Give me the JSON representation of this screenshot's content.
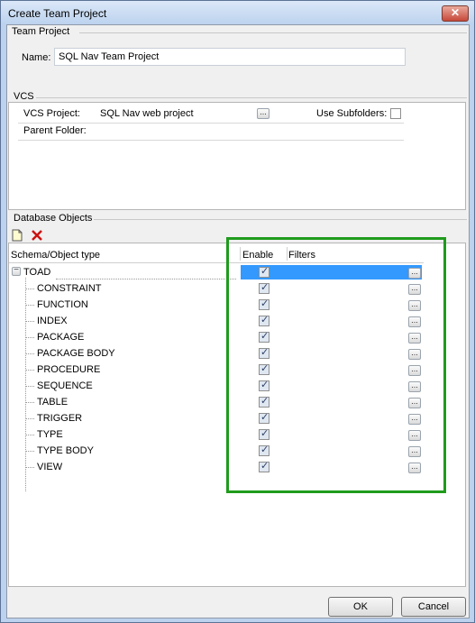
{
  "window": {
    "title": "Create Team Project",
    "close_label": "✕"
  },
  "team_project": {
    "section": "Team Project",
    "name_label": "Name:",
    "name_value": "SQL Nav Team Project"
  },
  "vcs": {
    "section": "VCS",
    "project_label": "VCS Project:",
    "project_value": "SQL Nav web project",
    "browse_label": "...",
    "use_subfolders_label": "Use Subfolders:",
    "use_subfolders_checked": false,
    "parent_folder_label": "Parent Folder:"
  },
  "db": {
    "section": "Database Objects",
    "columns": {
      "schema": "Schema/Object type",
      "enable": "Enable",
      "filters": "Filters"
    },
    "root": {
      "label": "TOAD",
      "enabled": true,
      "expand": "−"
    },
    "items": [
      {
        "label": "CONSTRAINT",
        "enabled": true
      },
      {
        "label": "FUNCTION",
        "enabled": true
      },
      {
        "label": "INDEX",
        "enabled": true
      },
      {
        "label": "PACKAGE",
        "enabled": true
      },
      {
        "label": "PACKAGE BODY",
        "enabled": true
      },
      {
        "label": "PROCEDURE",
        "enabled": true
      },
      {
        "label": "SEQUENCE",
        "enabled": true
      },
      {
        "label": "TABLE",
        "enabled": true
      },
      {
        "label": "TRIGGER",
        "enabled": true
      },
      {
        "label": "TYPE",
        "enabled": true
      },
      {
        "label": "TYPE BODY",
        "enabled": true
      },
      {
        "label": "VIEW",
        "enabled": true
      }
    ],
    "filter_btn_label": "..."
  },
  "footer": {
    "ok_label": "OK",
    "cancel_label": "Cancel"
  },
  "colors": {
    "highlight": "#3399ff",
    "annotation_green": "#1f9b1c",
    "delete_red": "#cc1111"
  }
}
